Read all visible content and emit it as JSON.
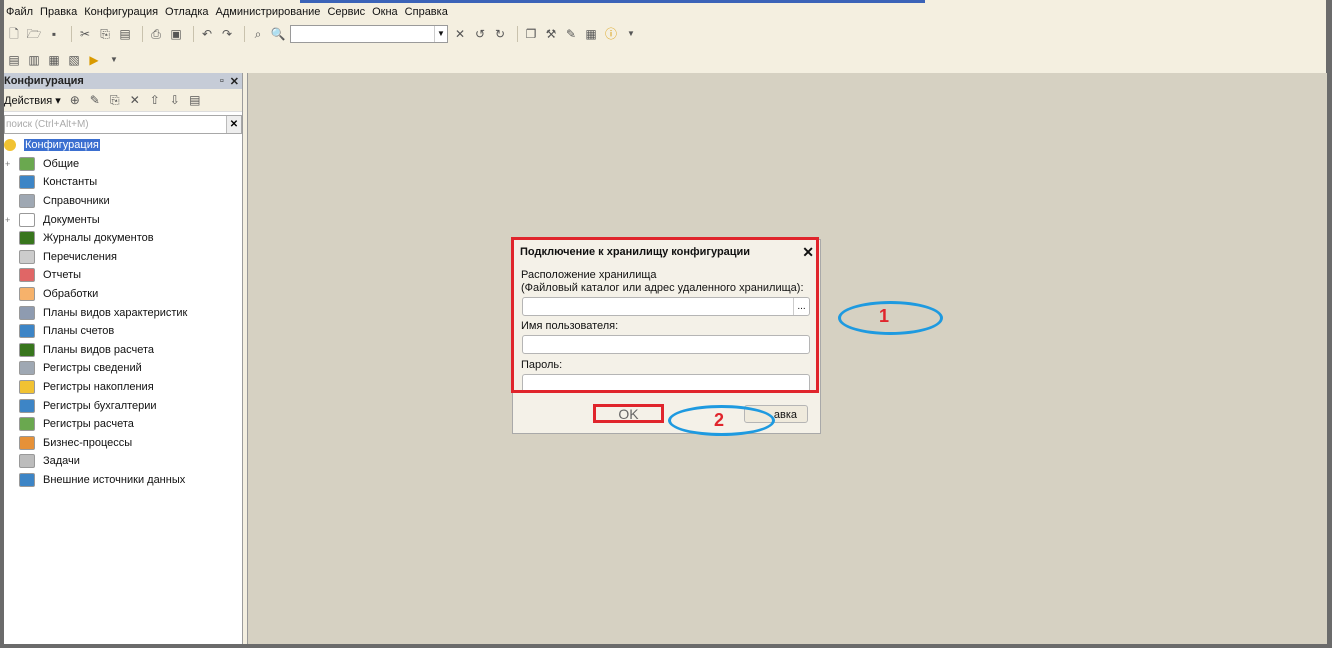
{
  "menu": [
    "Файл",
    "Правка",
    "Конфигурация",
    "Отладка",
    "Администрирование",
    "Сервис",
    "Окна",
    "Справка"
  ],
  "panel": {
    "title": "Конфигурация",
    "actions_label": "Действия",
    "search_placeholder": "поиск (Ctrl+Alt+M)",
    "tree": [
      {
        "label": "Конфигурация",
        "root": true,
        "color": "#f1c232"
      },
      {
        "label": "Общие",
        "expand": "+",
        "color": "#6aa84f"
      },
      {
        "label": "Константы",
        "color": "#3d85c6"
      },
      {
        "label": "Справочники",
        "color": "#9fa8b3"
      },
      {
        "label": "Документы",
        "expand": "+",
        "color": "#ffffff"
      },
      {
        "label": "Журналы документов",
        "color": "#38761d"
      },
      {
        "label": "Перечисления",
        "color": "#cccccc"
      },
      {
        "label": "Отчеты",
        "color": "#e06666"
      },
      {
        "label": "Обработки",
        "color": "#f6b26b"
      },
      {
        "label": "Планы видов характеристик",
        "color": "#8e9bb0"
      },
      {
        "label": "Планы счетов",
        "color": "#3d85c6"
      },
      {
        "label": "Планы видов расчета",
        "color": "#38761d"
      },
      {
        "label": "Регистры сведений",
        "color": "#9fa8b3"
      },
      {
        "label": "Регистры накопления",
        "color": "#f1c232"
      },
      {
        "label": "Регистры бухгалтерии",
        "color": "#3d85c6"
      },
      {
        "label": "Регистры расчета",
        "color": "#6aa84f"
      },
      {
        "label": "Бизнес-процессы",
        "color": "#e69138"
      },
      {
        "label": "Задачи",
        "color": "#bcbcbc"
      },
      {
        "label": "Внешние источники данных",
        "color": "#3d85c6"
      }
    ]
  },
  "dialog": {
    "title": "Подключение к хранилищу конфигурации",
    "close": "✕",
    "location_label": "Расположение хранилища",
    "location_hint": "(Файловый каталог или адрес удаленного хранилища):",
    "location_value": "",
    "location_browse": "...",
    "user_label": "Имя пользователя:",
    "user_value": "",
    "password_label": "Пароль:",
    "password_value": "",
    "ok_label": "OK",
    "help_label": "авка"
  },
  "annotations": {
    "one": "1",
    "two": "2"
  }
}
